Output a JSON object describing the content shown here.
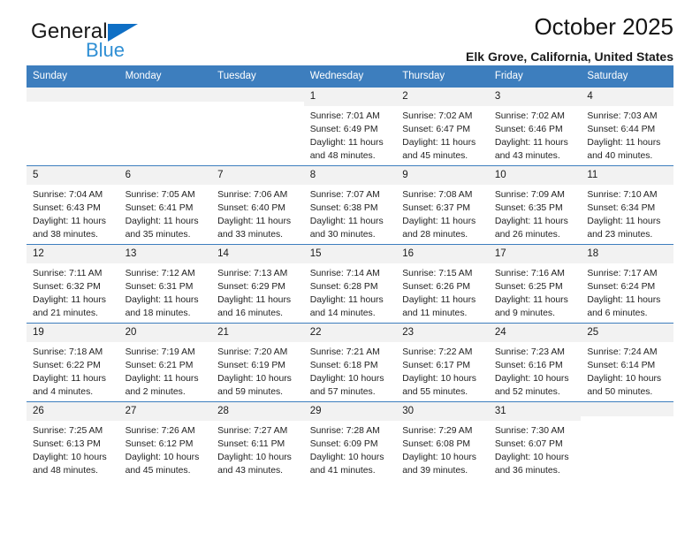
{
  "brand": {
    "name_top": "General",
    "name_bottom": "Blue",
    "triangle_color": "#0f6fc5",
    "blue_text_color": "#2f8fd4"
  },
  "header": {
    "title": "October 2025",
    "subtitle": "Elk Grove, California, United States"
  },
  "theme": {
    "header_blue": "#3d7ebe",
    "daynum_band": "#f2f2f2",
    "text": "#1a1a1a"
  },
  "weekday_headers": [
    "Sunday",
    "Monday",
    "Tuesday",
    "Wednesday",
    "Thursday",
    "Friday",
    "Saturday"
  ],
  "labels": {
    "sunrise_prefix": "Sunrise: ",
    "sunset_prefix": "Sunset: ",
    "daylight_prefix": "Daylight: "
  },
  "weeks": [
    [
      {
        "day": "",
        "empty": true
      },
      {
        "day": "",
        "empty": true
      },
      {
        "day": "",
        "empty": true
      },
      {
        "day": "1",
        "sunrise": "Sunrise: 7:01 AM",
        "sunset": "Sunset: 6:49 PM",
        "daylight_line1": "Daylight: 11 hours",
        "daylight_line2": "and 48 minutes."
      },
      {
        "day": "2",
        "sunrise": "Sunrise: 7:02 AM",
        "sunset": "Sunset: 6:47 PM",
        "daylight_line1": "Daylight: 11 hours",
        "daylight_line2": "and 45 minutes."
      },
      {
        "day": "3",
        "sunrise": "Sunrise: 7:02 AM",
        "sunset": "Sunset: 6:46 PM",
        "daylight_line1": "Daylight: 11 hours",
        "daylight_line2": "and 43 minutes."
      },
      {
        "day": "4",
        "sunrise": "Sunrise: 7:03 AM",
        "sunset": "Sunset: 6:44 PM",
        "daylight_line1": "Daylight: 11 hours",
        "daylight_line2": "and 40 minutes."
      }
    ],
    [
      {
        "day": "5",
        "sunrise": "Sunrise: 7:04 AM",
        "sunset": "Sunset: 6:43 PM",
        "daylight_line1": "Daylight: 11 hours",
        "daylight_line2": "and 38 minutes."
      },
      {
        "day": "6",
        "sunrise": "Sunrise: 7:05 AM",
        "sunset": "Sunset: 6:41 PM",
        "daylight_line1": "Daylight: 11 hours",
        "daylight_line2": "and 35 minutes."
      },
      {
        "day": "7",
        "sunrise": "Sunrise: 7:06 AM",
        "sunset": "Sunset: 6:40 PM",
        "daylight_line1": "Daylight: 11 hours",
        "daylight_line2": "and 33 minutes."
      },
      {
        "day": "8",
        "sunrise": "Sunrise: 7:07 AM",
        "sunset": "Sunset: 6:38 PM",
        "daylight_line1": "Daylight: 11 hours",
        "daylight_line2": "and 30 minutes."
      },
      {
        "day": "9",
        "sunrise": "Sunrise: 7:08 AM",
        "sunset": "Sunset: 6:37 PM",
        "daylight_line1": "Daylight: 11 hours",
        "daylight_line2": "and 28 minutes."
      },
      {
        "day": "10",
        "sunrise": "Sunrise: 7:09 AM",
        "sunset": "Sunset: 6:35 PM",
        "daylight_line1": "Daylight: 11 hours",
        "daylight_line2": "and 26 minutes."
      },
      {
        "day": "11",
        "sunrise": "Sunrise: 7:10 AM",
        "sunset": "Sunset: 6:34 PM",
        "daylight_line1": "Daylight: 11 hours",
        "daylight_line2": "and 23 minutes."
      }
    ],
    [
      {
        "day": "12",
        "sunrise": "Sunrise: 7:11 AM",
        "sunset": "Sunset: 6:32 PM",
        "daylight_line1": "Daylight: 11 hours",
        "daylight_line2": "and 21 minutes."
      },
      {
        "day": "13",
        "sunrise": "Sunrise: 7:12 AM",
        "sunset": "Sunset: 6:31 PM",
        "daylight_line1": "Daylight: 11 hours",
        "daylight_line2": "and 18 minutes."
      },
      {
        "day": "14",
        "sunrise": "Sunrise: 7:13 AM",
        "sunset": "Sunset: 6:29 PM",
        "daylight_line1": "Daylight: 11 hours",
        "daylight_line2": "and 16 minutes."
      },
      {
        "day": "15",
        "sunrise": "Sunrise: 7:14 AM",
        "sunset": "Sunset: 6:28 PM",
        "daylight_line1": "Daylight: 11 hours",
        "daylight_line2": "and 14 minutes."
      },
      {
        "day": "16",
        "sunrise": "Sunrise: 7:15 AM",
        "sunset": "Sunset: 6:26 PM",
        "daylight_line1": "Daylight: 11 hours",
        "daylight_line2": "and 11 minutes."
      },
      {
        "day": "17",
        "sunrise": "Sunrise: 7:16 AM",
        "sunset": "Sunset: 6:25 PM",
        "daylight_line1": "Daylight: 11 hours",
        "daylight_line2": "and 9 minutes."
      },
      {
        "day": "18",
        "sunrise": "Sunrise: 7:17 AM",
        "sunset": "Sunset: 6:24 PM",
        "daylight_line1": "Daylight: 11 hours",
        "daylight_line2": "and 6 minutes."
      }
    ],
    [
      {
        "day": "19",
        "sunrise": "Sunrise: 7:18 AM",
        "sunset": "Sunset: 6:22 PM",
        "daylight_line1": "Daylight: 11 hours",
        "daylight_line2": "and 4 minutes."
      },
      {
        "day": "20",
        "sunrise": "Sunrise: 7:19 AM",
        "sunset": "Sunset: 6:21 PM",
        "daylight_line1": "Daylight: 11 hours",
        "daylight_line2": "and 2 minutes."
      },
      {
        "day": "21",
        "sunrise": "Sunrise: 7:20 AM",
        "sunset": "Sunset: 6:19 PM",
        "daylight_line1": "Daylight: 10 hours",
        "daylight_line2": "and 59 minutes."
      },
      {
        "day": "22",
        "sunrise": "Sunrise: 7:21 AM",
        "sunset": "Sunset: 6:18 PM",
        "daylight_line1": "Daylight: 10 hours",
        "daylight_line2": "and 57 minutes."
      },
      {
        "day": "23",
        "sunrise": "Sunrise: 7:22 AM",
        "sunset": "Sunset: 6:17 PM",
        "daylight_line1": "Daylight: 10 hours",
        "daylight_line2": "and 55 minutes."
      },
      {
        "day": "24",
        "sunrise": "Sunrise: 7:23 AM",
        "sunset": "Sunset: 6:16 PM",
        "daylight_line1": "Daylight: 10 hours",
        "daylight_line2": "and 52 minutes."
      },
      {
        "day": "25",
        "sunrise": "Sunrise: 7:24 AM",
        "sunset": "Sunset: 6:14 PM",
        "daylight_line1": "Daylight: 10 hours",
        "daylight_line2": "and 50 minutes."
      }
    ],
    [
      {
        "day": "26",
        "sunrise": "Sunrise: 7:25 AM",
        "sunset": "Sunset: 6:13 PM",
        "daylight_line1": "Daylight: 10 hours",
        "daylight_line2": "and 48 minutes."
      },
      {
        "day": "27",
        "sunrise": "Sunrise: 7:26 AM",
        "sunset": "Sunset: 6:12 PM",
        "daylight_line1": "Daylight: 10 hours",
        "daylight_line2": "and 45 minutes."
      },
      {
        "day": "28",
        "sunrise": "Sunrise: 7:27 AM",
        "sunset": "Sunset: 6:11 PM",
        "daylight_line1": "Daylight: 10 hours",
        "daylight_line2": "and 43 minutes."
      },
      {
        "day": "29",
        "sunrise": "Sunrise: 7:28 AM",
        "sunset": "Sunset: 6:09 PM",
        "daylight_line1": "Daylight: 10 hours",
        "daylight_line2": "and 41 minutes."
      },
      {
        "day": "30",
        "sunrise": "Sunrise: 7:29 AM",
        "sunset": "Sunset: 6:08 PM",
        "daylight_line1": "Daylight: 10 hours",
        "daylight_line2": "and 39 minutes."
      },
      {
        "day": "31",
        "sunrise": "Sunrise: 7:30 AM",
        "sunset": "Sunset: 6:07 PM",
        "daylight_line1": "Daylight: 10 hours",
        "daylight_line2": "and 36 minutes."
      },
      {
        "day": "",
        "empty": true
      }
    ]
  ]
}
